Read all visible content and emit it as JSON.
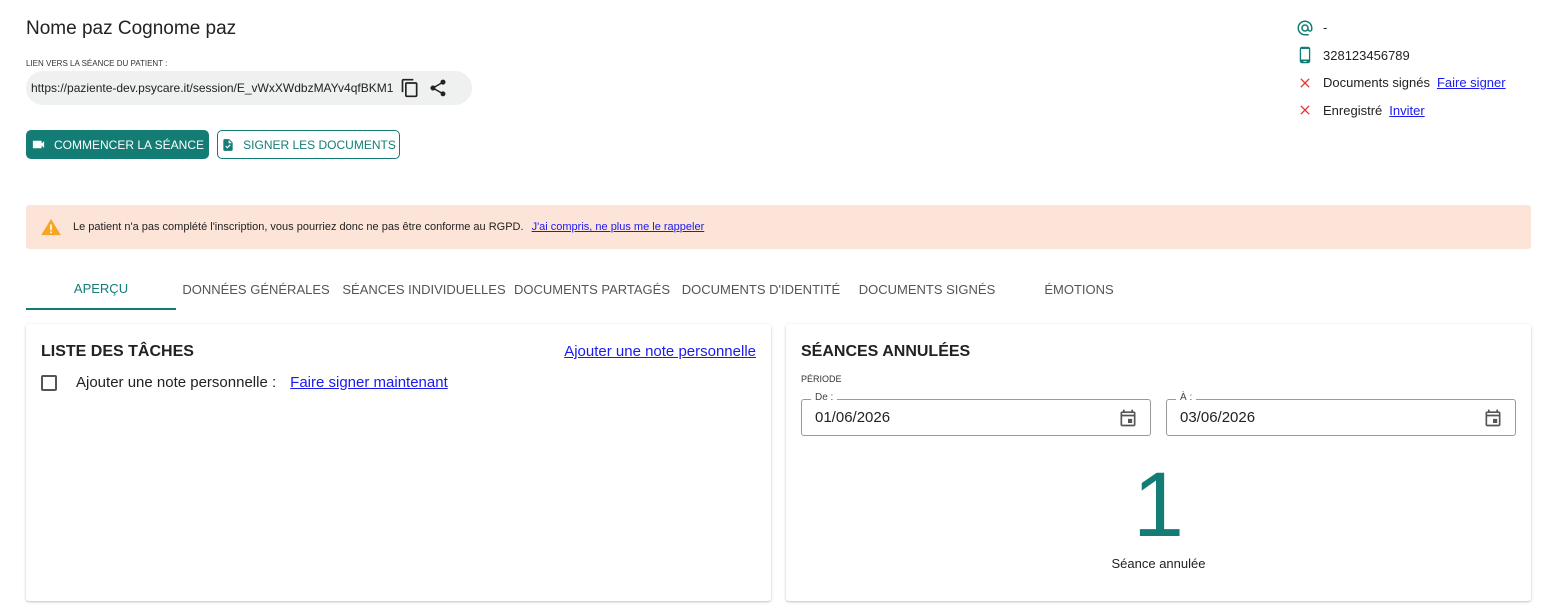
{
  "patient": {
    "name": "Nome paz Cognome paz",
    "session_link_label": "LIEN VERS LA SÉANCE DU PATIENT :",
    "session_link_url": "https://paziente-dev.psycare.it/session/E_vWxXWdbzMAYv4qfBKM1"
  },
  "actions": {
    "start_session": "COMMENCER LA SÉANCE",
    "sign_documents": "SIGNER LES DOCUMENTS"
  },
  "contact": {
    "email": "-",
    "phone": "328123456789",
    "documents_signed_label": "Documents signés",
    "documents_signed_link": "Faire signer",
    "registered_label": "Enregistré",
    "registered_link": "Inviter"
  },
  "alert": {
    "message": "Le patient n'a pas complété l'inscription, vous pourriez donc ne pas être conforme au RGPD.",
    "dismiss_link": "J'ai compris, ne plus me le rappeler"
  },
  "tabs": [
    {
      "label": "APERÇU",
      "active": true
    },
    {
      "label": "DONNÉES GÉNÉRALES",
      "active": false
    },
    {
      "label": "SÉANCES INDIVIDUELLES",
      "active": false
    },
    {
      "label": "DOCUMENTS PARTAGÉS",
      "active": false
    },
    {
      "label": "DOCUMENTS D'IDENTITÉ",
      "active": false
    },
    {
      "label": "DOCUMENTS SIGNÉS",
      "active": false
    },
    {
      "label": "ÉMOTIONS",
      "active": false
    }
  ],
  "tasks": {
    "title": "LISTE DES TÂCHES",
    "add_note_link": "Ajouter une note personnelle",
    "items": [
      {
        "label": "Ajouter une note personnelle :",
        "link": "Faire signer maintenant",
        "checked": false
      }
    ]
  },
  "cancelled": {
    "title": "SÉANCES ANNULÉES",
    "period_label": "PÉRIODE",
    "from_legend": "De :",
    "from_value": "01/06/2026",
    "to_legend": "À :",
    "to_value": "03/06/2026",
    "count": "1",
    "count_label": "Séance annulée"
  },
  "colors": {
    "primary": "#137d75",
    "alert_bg": "#fde4d8",
    "error": "#e53935",
    "warning": "#f5a623",
    "link": "#1a1aee"
  }
}
